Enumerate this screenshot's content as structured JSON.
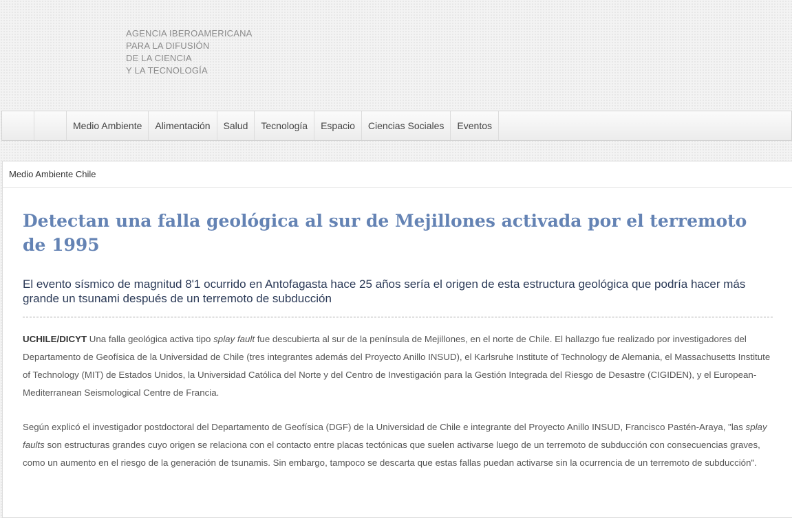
{
  "header": {
    "agency_lines": [
      "AGENCIA IBEROAMERICANA",
      "PARA LA DIFUSIÓN",
      "DE LA CIENCIA",
      "Y LA TECNOLOGÍA"
    ]
  },
  "nav": {
    "items": [
      "Medio Ambiente",
      "Alimentación",
      "Salud",
      "Tecnología",
      "Espacio",
      "Ciencias Sociales",
      "Eventos"
    ]
  },
  "breadcrumb": "Medio Ambiente Chile",
  "article": {
    "title": "Detectan una falla geológica al sur de Mejillones activada por el terremoto de 1995",
    "subtitle": "El evento sísmico de magnitud 8'1 ocurrido en Antofagasta hace 25 años sería el origen de esta estructura geológica que podría hacer más grande un tsunami después de un terremoto de subducción",
    "p1": {
      "source": "UCHILE/DICYT",
      "t1": " Una falla geológica activa tipo ",
      "em1": "splay fault",
      "t2": " fue descubierta al sur de la península de Mejillones, en el norte de Chile. El hallazgo fue realizado por investigadores del Departamento de Geofísica de la Universidad de Chile (tres integrantes además del Proyecto Anillo INSUD), el Karlsruhe Institute of Technology de Alemania, el Massachusetts Institute of Technology (MIT) de Estados Unidos, la Universidad Católica del Norte y del Centro de Investigación para la Gestión Integrada del Riesgo de Desastre (CIGIDEN), y el European-Mediterranean Seismological Centre de Francia."
    },
    "p2": {
      "t1": "Según explicó el investigador postdoctoral del Departamento de Geofísica (DGF) de la Universidad de Chile e integrante del Proyecto Anillo INSUD, Francisco Pastén-Araya, \"las ",
      "em1": "splay faults",
      "t2": " son estructuras grandes cuyo origen se relaciona con el contacto entre placas tectónicas que suelen activarse luego de un terremoto de subducción con consecuencias graves, como un aumento en el riesgo de la generación de tsunamis. Sin embargo, tampoco se descarta que estas fallas puedan activarse sin la ocurrencia de un terremoto de subducción\"."
    }
  }
}
